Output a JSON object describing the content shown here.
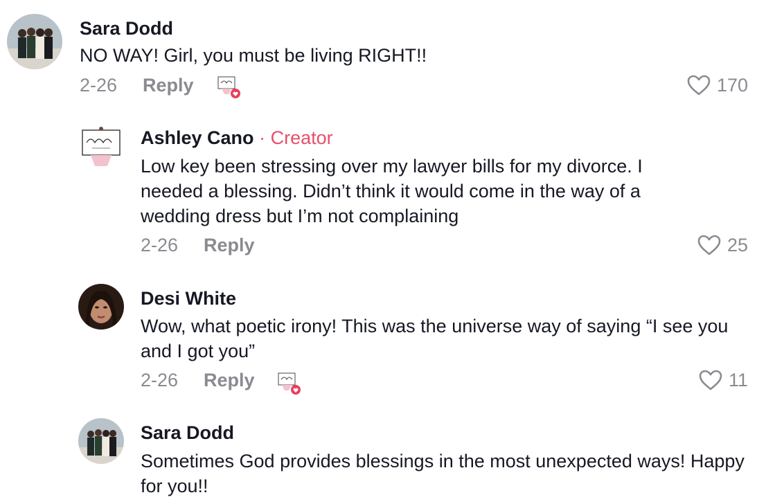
{
  "comments": [
    {
      "author": "Sara Dodd",
      "text": "NO WAY! Girl, you must be living RIGHT!!",
      "date": "2-26",
      "reply_label": "Reply",
      "likes": "170",
      "liked_by_creator": true
    },
    {
      "author": "Ashley Cano",
      "badge_separator": "·",
      "badge": "Creator",
      "text": "Low key been stressing over my lawyer bills for my divorce. I needed a blessing. Didn’t think it would come in the way of a wedding dress but I’m not complaining",
      "date": "2-26",
      "reply_label": "Reply",
      "likes": "25",
      "liked_by_creator": false
    },
    {
      "author": "Desi White",
      "text": "Wow, what poetic irony! This was the universe way of saying “I see you and I got you”",
      "date": "2-26",
      "reply_label": "Reply",
      "likes": "11",
      "liked_by_creator": true
    },
    {
      "author": "Sara Dodd",
      "text": "Sometimes God provides blessings in the most unexpected ways! Happy for you!!"
    }
  ],
  "icons": {
    "like": "heart-outline-icon",
    "creator_liked": "creator-liked-badge-icon"
  },
  "colors": {
    "accent": "#e84e6a",
    "muted": "#8a8b91",
    "text": "#161823"
  }
}
